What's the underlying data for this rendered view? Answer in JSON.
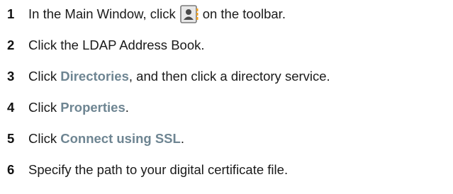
{
  "steps": [
    {
      "number": "1",
      "text_before": "In the Main Window, click",
      "icon": "address-book-icon",
      "text_after": "on the toolbar."
    },
    {
      "number": "2",
      "text": "Click the LDAP Address Book."
    },
    {
      "number": "3",
      "text_before": "Click ",
      "term": "Directories",
      "text_after": ", and then click a directory service."
    },
    {
      "number": "4",
      "text_before": "Click ",
      "term": "Properties",
      "text_after": "."
    },
    {
      "number": "5",
      "text_before": "Click ",
      "term": "Connect using SSL",
      "text_after": "."
    },
    {
      "number": "6",
      "text": "Specify the path to your digital certificate file."
    }
  ],
  "colors": {
    "text": "#1a1a1a",
    "ui_term": "#6e8592",
    "icon_frame": "#7a7a7a",
    "icon_face": "#e8e8e8"
  }
}
